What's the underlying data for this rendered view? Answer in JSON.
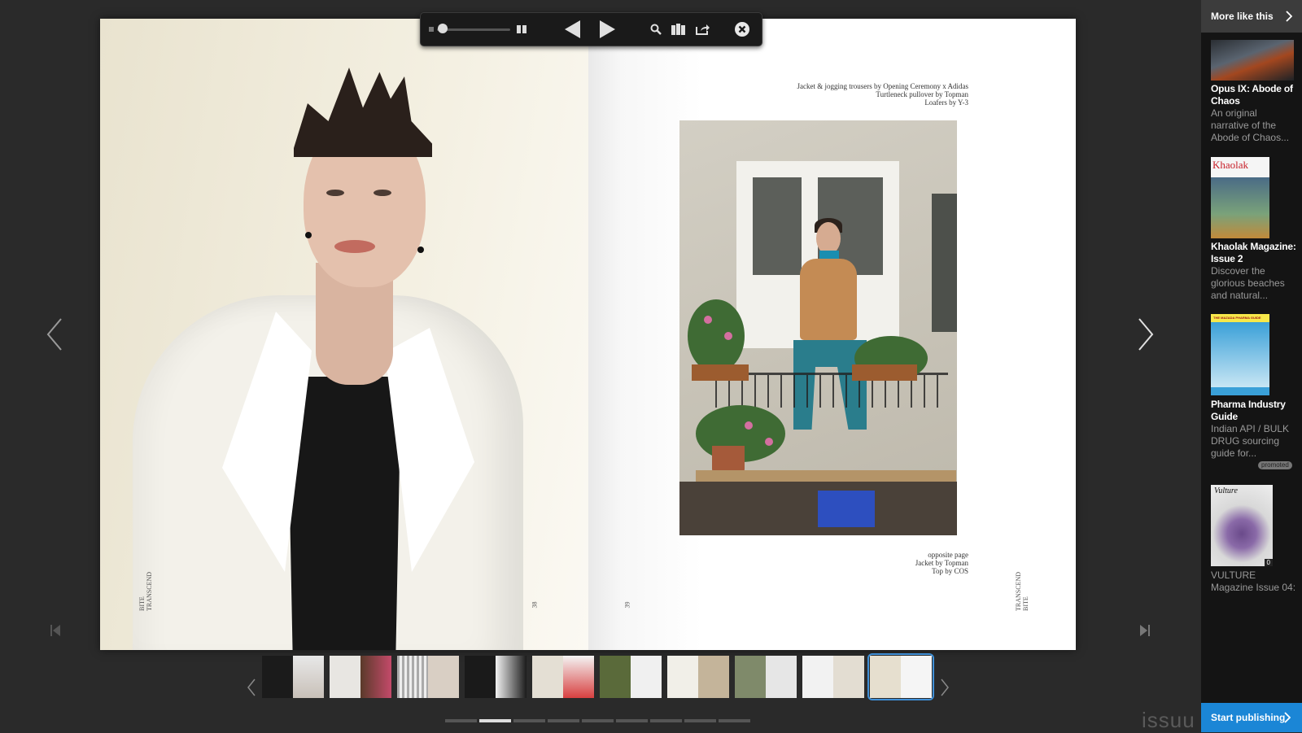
{
  "reader": {
    "right_page": {
      "credits_top": [
        "Jacket & jogging trousers by Opening Ceremony x Adidas",
        "Turtleneck pullover by Topman",
        "Loafers by Y-3"
      ],
      "credits_bottom": [
        "opposite page",
        "Jacket by Topman",
        "Top by COS"
      ],
      "page_number": "39",
      "spine_text": "TRANSCEND\nBITE"
    },
    "left_page": {
      "page_number": "38",
      "spine_text": "BITE\nTRANSCEND"
    }
  },
  "toolbar": {
    "zoom_icon": "zoom-slider",
    "grid_icon": "grid-icon",
    "prev_icon": "triangle-left-icon",
    "next_icon": "triangle-right-icon",
    "search_icon": "magnifier-icon",
    "library_icon": "stack-icon",
    "share_icon": "share-icon",
    "close_icon": "close-circle-icon"
  },
  "thumbnails": {
    "count": 10,
    "active_index": 9
  },
  "page_dots": {
    "count": 9,
    "active_index": 1
  },
  "sidebar": {
    "header": "More like this",
    "items": [
      {
        "title": "Opus IX: Abode of Chaos",
        "desc": "An original narrative of the Abode of Chaos..."
      },
      {
        "title": "Khaolak Magazine: Issue 2",
        "desc": "Discover the glorious beaches and natural...",
        "cover_text": "Khaolak"
      },
      {
        "title": "Pharma Industry Guide",
        "desc": "Indian API / BULK DRUG sourcing guide for...",
        "badge": "promoted",
        "cover_text": "THE MAZADA PHARMA GUIDE"
      },
      {
        "title": "",
        "desc": "VULTURE Magazine Issue 04:",
        "cover_text": "Vulture",
        "count": "0"
      }
    ],
    "cta": "Start publishing"
  },
  "brand": "issuu",
  "colors": {
    "accent": "#1b86d6",
    "background": "#2a2a2a",
    "sidebar": "#141414"
  }
}
